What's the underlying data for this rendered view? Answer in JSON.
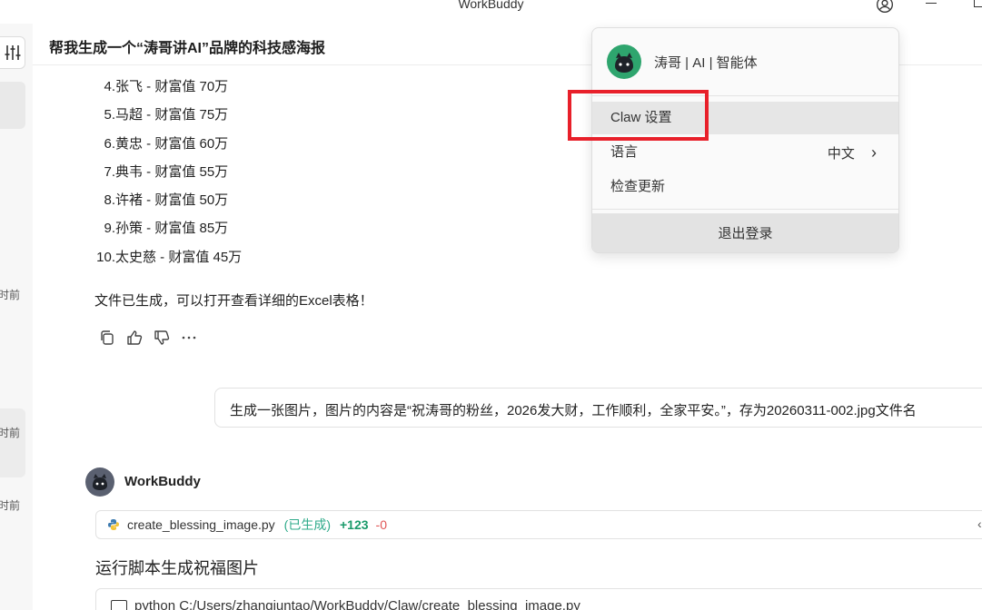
{
  "window": {
    "title": "WorkBuddy"
  },
  "sidebar": {
    "time_labels": [
      "时前",
      "时前",
      "时前"
    ]
  },
  "header": {
    "title": "帮我生成一个“涛哥讲AI”品牌的科技感海报"
  },
  "list": [
    {
      "num": "4.",
      "text": "张飞 - 财富值 70万"
    },
    {
      "num": "5.",
      "text": "马超 - 财富值 75万"
    },
    {
      "num": "6.",
      "text": "黄忠 - 财富值 60万"
    },
    {
      "num": "7.",
      "text": "典韦 - 财富值 55万"
    },
    {
      "num": "8.",
      "text": "许褚 - 财富值 50万"
    },
    {
      "num": "9.",
      "text": "孙策 - 财富值 85万"
    },
    {
      "num": "10.",
      "text": "太史慈 - 财富值 45万"
    }
  ],
  "summary": "文件已生成，可以打开查看详细的Excel表格！",
  "user_message": "生成一张图片，图片的内容是“祝涛哥的粉丝，2026发大财，工作顺利，全家平安。”，存为20260311-002.jpg文件名",
  "assistant": {
    "name": "WorkBuddy",
    "file": {
      "name": "create_blessing_image.py",
      "status": "(已生成)",
      "added": "+123",
      "removed": "-0"
    },
    "step_title": "运行脚本生成祝福图片",
    "command": "python C:/Users/zhangjuntao/WorkBuddy/Claw/create_blessing_image.py"
  },
  "menu": {
    "username": "涛哥 | AI | 智能体",
    "items": {
      "claw_settings": "Claw 设置",
      "language": "语言",
      "language_value": "中文",
      "check_update": "检查更新",
      "logout": "退出登录"
    }
  },
  "colors": {
    "highlight_border": "#e8202a",
    "status_green": "#2eaa8a",
    "added_green": "#1a9a6a",
    "removed_red": "#e05555"
  }
}
